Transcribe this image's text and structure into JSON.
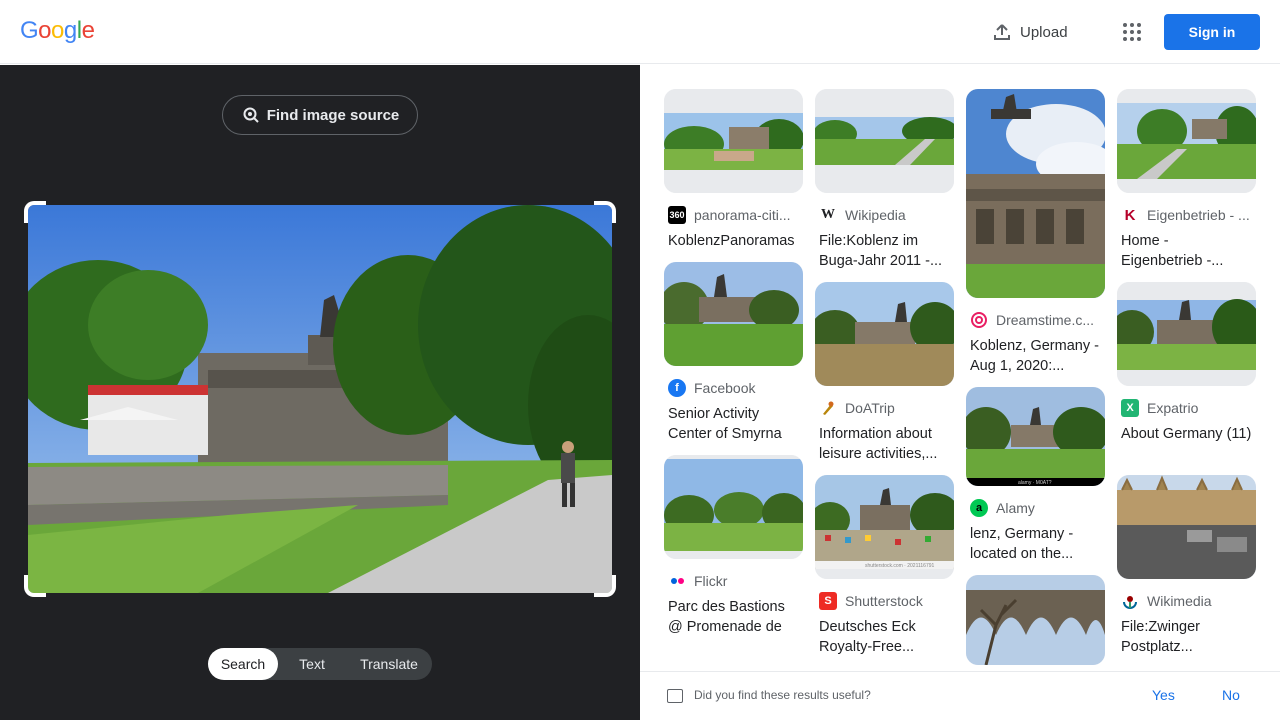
{
  "header": {
    "logo": [
      "G",
      "o",
      "o",
      "g",
      "l",
      "e"
    ],
    "upload_label": "Upload",
    "signin_label": "Sign in"
  },
  "left_panel": {
    "find_source_label": "Find image source",
    "modes": [
      "Search",
      "Text",
      "Translate"
    ],
    "active_mode": "Search"
  },
  "results": [
    {
      "source": "panorama-citi...",
      "title": "KoblenzPanoramas",
      "favicon": "360"
    },
    {
      "source": "Facebook",
      "title": "Senior Activity Center of Smyrna",
      "favicon": "f"
    },
    {
      "source": "Flickr",
      "title": "Parc des Bastions @ Promenade de l...",
      "favicon": "flickr"
    },
    {
      "source": "Wikipedia",
      "title": "File:Koblenz im Buga-Jahr 2011 -...",
      "favicon": "W"
    },
    {
      "source": "DoATrip",
      "title": "Information about leisure activities,...",
      "favicon": "doatrip"
    },
    {
      "source": "Shutterstock",
      "title": "Deutsches Eck Royalty-Free...",
      "favicon": "S"
    },
    {
      "source": "Dreamstime.c...",
      "title": "Koblenz, Germany - Aug 1, 2020:...",
      "favicon": "dreamstime"
    },
    {
      "source": "Alamy",
      "title": "lenz, Germany - located on the...",
      "favicon": "a"
    },
    {
      "source": "Eigenbetrieb - ...",
      "title": "Home - Eigenbetrieb -...",
      "favicon": "K"
    },
    {
      "source": "Expatrio",
      "title": "About Germany (11)",
      "favicon": "X"
    },
    {
      "source": "Wikimedia",
      "title": "File:Zwinger Postplatz...",
      "favicon": "wikimedia"
    }
  ],
  "watermarks": {
    "alamy": "alamy · M0AT?",
    "shutterstock": "shutterstock.com · 2021116791"
  },
  "feedback": {
    "question": "Did you find these results useful?",
    "yes": "Yes",
    "no": "No"
  },
  "colors": {
    "accent": "#1a73e8",
    "dark_panel": "#202124"
  }
}
